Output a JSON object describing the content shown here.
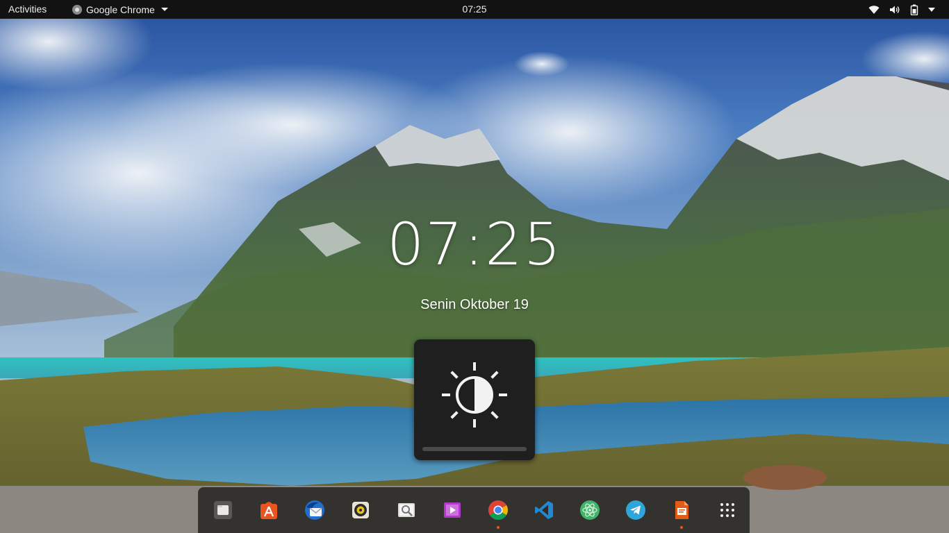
{
  "topbar": {
    "activities_label": "Activities",
    "app_name": "Google Chrome",
    "clock": "07:25",
    "tray_icons": [
      "wifi-icon",
      "volume-icon",
      "battery-icon",
      "system-menu-caret-icon"
    ]
  },
  "desktop": {
    "clock": "07:25",
    "date": "Senin Oktober 19"
  },
  "osd": {
    "icon": "brightness-icon",
    "level": 0
  },
  "dock": {
    "items": [
      {
        "name": "files",
        "icon": "folder-icon",
        "running": false
      },
      {
        "name": "software",
        "icon": "app-store-icon",
        "running": false
      },
      {
        "name": "thunderbird",
        "icon": "mail-icon",
        "running": false
      },
      {
        "name": "rhythmbox",
        "icon": "music-player-icon",
        "running": false
      },
      {
        "name": "image-viewer",
        "icon": "image-viewer-icon",
        "running": false
      },
      {
        "name": "videos",
        "icon": "video-player-icon",
        "running": false
      },
      {
        "name": "google-chrome",
        "icon": "chrome-icon",
        "running": true
      },
      {
        "name": "vscode",
        "icon": "vscode-icon",
        "running": false
      },
      {
        "name": "atom",
        "icon": "atom-icon",
        "running": false
      },
      {
        "name": "telegram",
        "icon": "telegram-icon",
        "running": false
      },
      {
        "name": "impress",
        "icon": "presentation-icon",
        "running": true
      },
      {
        "name": "show-applications",
        "icon": "app-grid-icon",
        "running": false
      }
    ]
  },
  "colors": {
    "topbar_bg": "#121212",
    "osd_bg": "#1f1f1f",
    "running_dot": "#e95420"
  }
}
